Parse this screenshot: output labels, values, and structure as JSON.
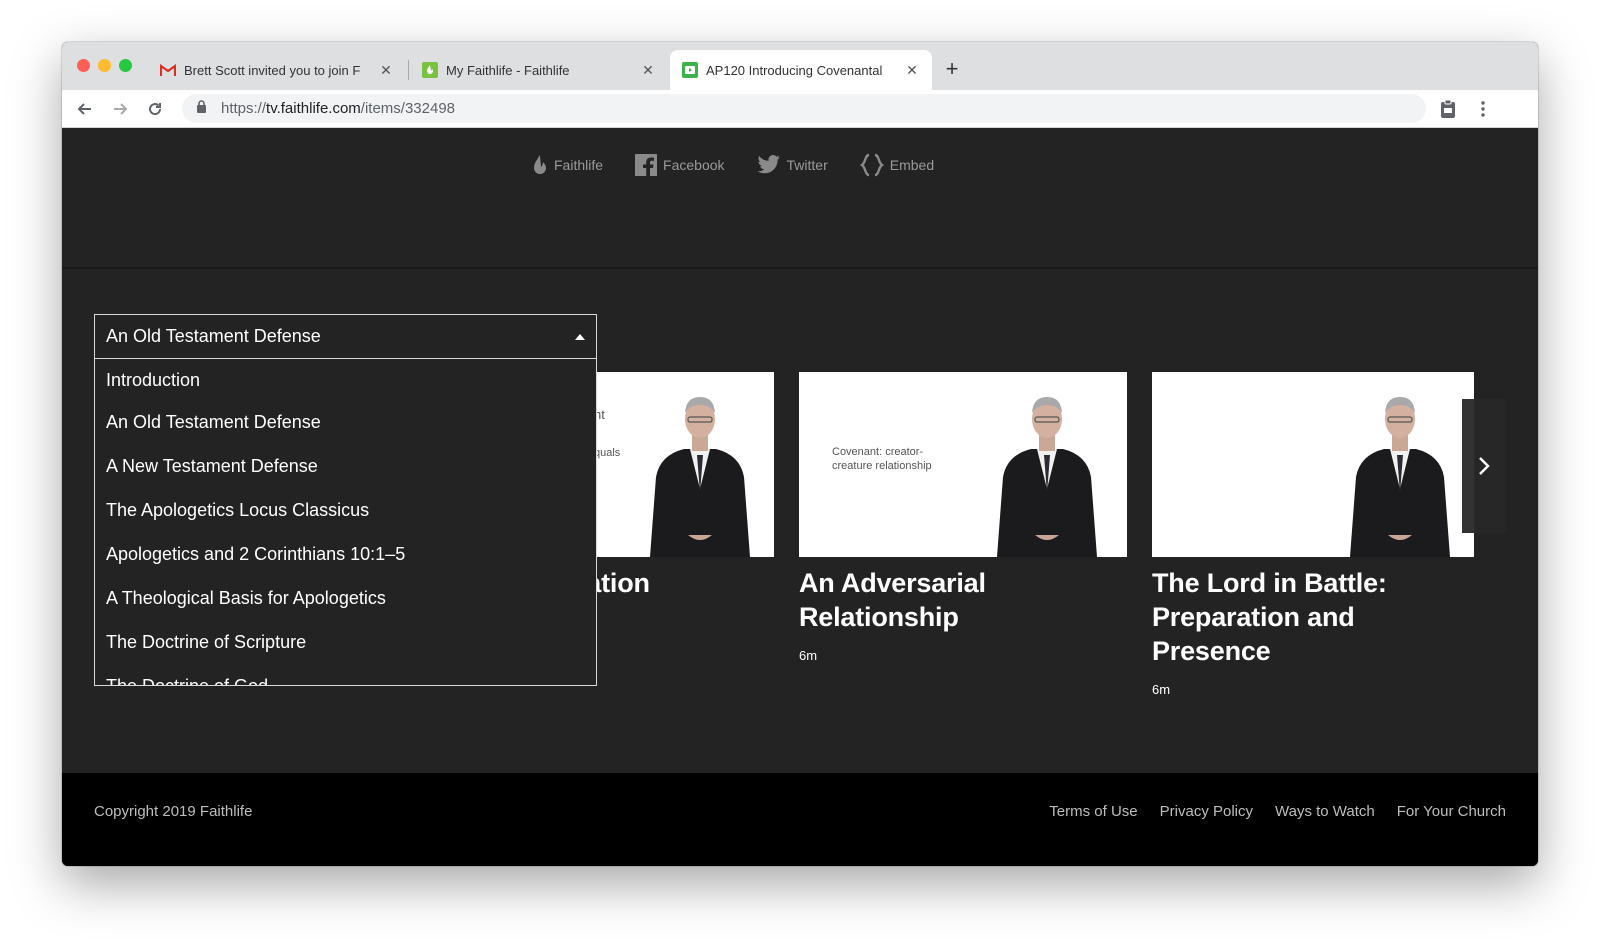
{
  "browser": {
    "tabs": [
      {
        "title": "Brett Scott invited you to join F",
        "favicon": "gmail-icon",
        "active": false
      },
      {
        "title": "My Faithlife - Faithlife",
        "favicon": "faithlife-icon",
        "active": false
      },
      {
        "title": "AP120 Introducing Covenantal",
        "favicon": "faithlife-tv-icon",
        "active": true
      }
    ],
    "url_prefix": "https://",
    "url_host": "tv.faithlife.com",
    "url_path": "/items/332498"
  },
  "share": {
    "links": [
      {
        "label": "Faithlife",
        "icon": "flame-icon"
      },
      {
        "label": "Facebook",
        "icon": "facebook-icon"
      },
      {
        "label": "Twitter",
        "icon": "twitter-icon"
      },
      {
        "label": "Embed",
        "icon": "embed-icon"
      }
    ]
  },
  "dropdown": {
    "selected": "An Old Testament Defense",
    "options": [
      "Introduction",
      "An Old Testament Defense",
      "A New Testament Defense",
      "The Apologetics Locus Classicus",
      "Apologetics and 2 Corinthians 10:1–5",
      "A Theological Basis for Apologetics",
      "The Doctrine of Scripture",
      "The Doctrine of God"
    ]
  },
  "cards": [
    {
      "title": "nd Creation",
      "slide_text_1": "nt",
      "slide_text_2": "quals",
      "duration": ""
    },
    {
      "title": "An Adversarial Relationship",
      "slide_text_1": "Covenant: creator-",
      "slide_text_2": "creature relationship",
      "duration": "6m"
    },
    {
      "title": "The Lord in Battle: Preparation and Presence",
      "slide_text_1": "",
      "slide_text_2": "",
      "duration": "6m"
    }
  ],
  "footer": {
    "copyright": "Copyright 2019 Faithlife",
    "links": [
      "Terms of Use",
      "Privacy Policy",
      "Ways to Watch",
      "For Your Church"
    ]
  }
}
